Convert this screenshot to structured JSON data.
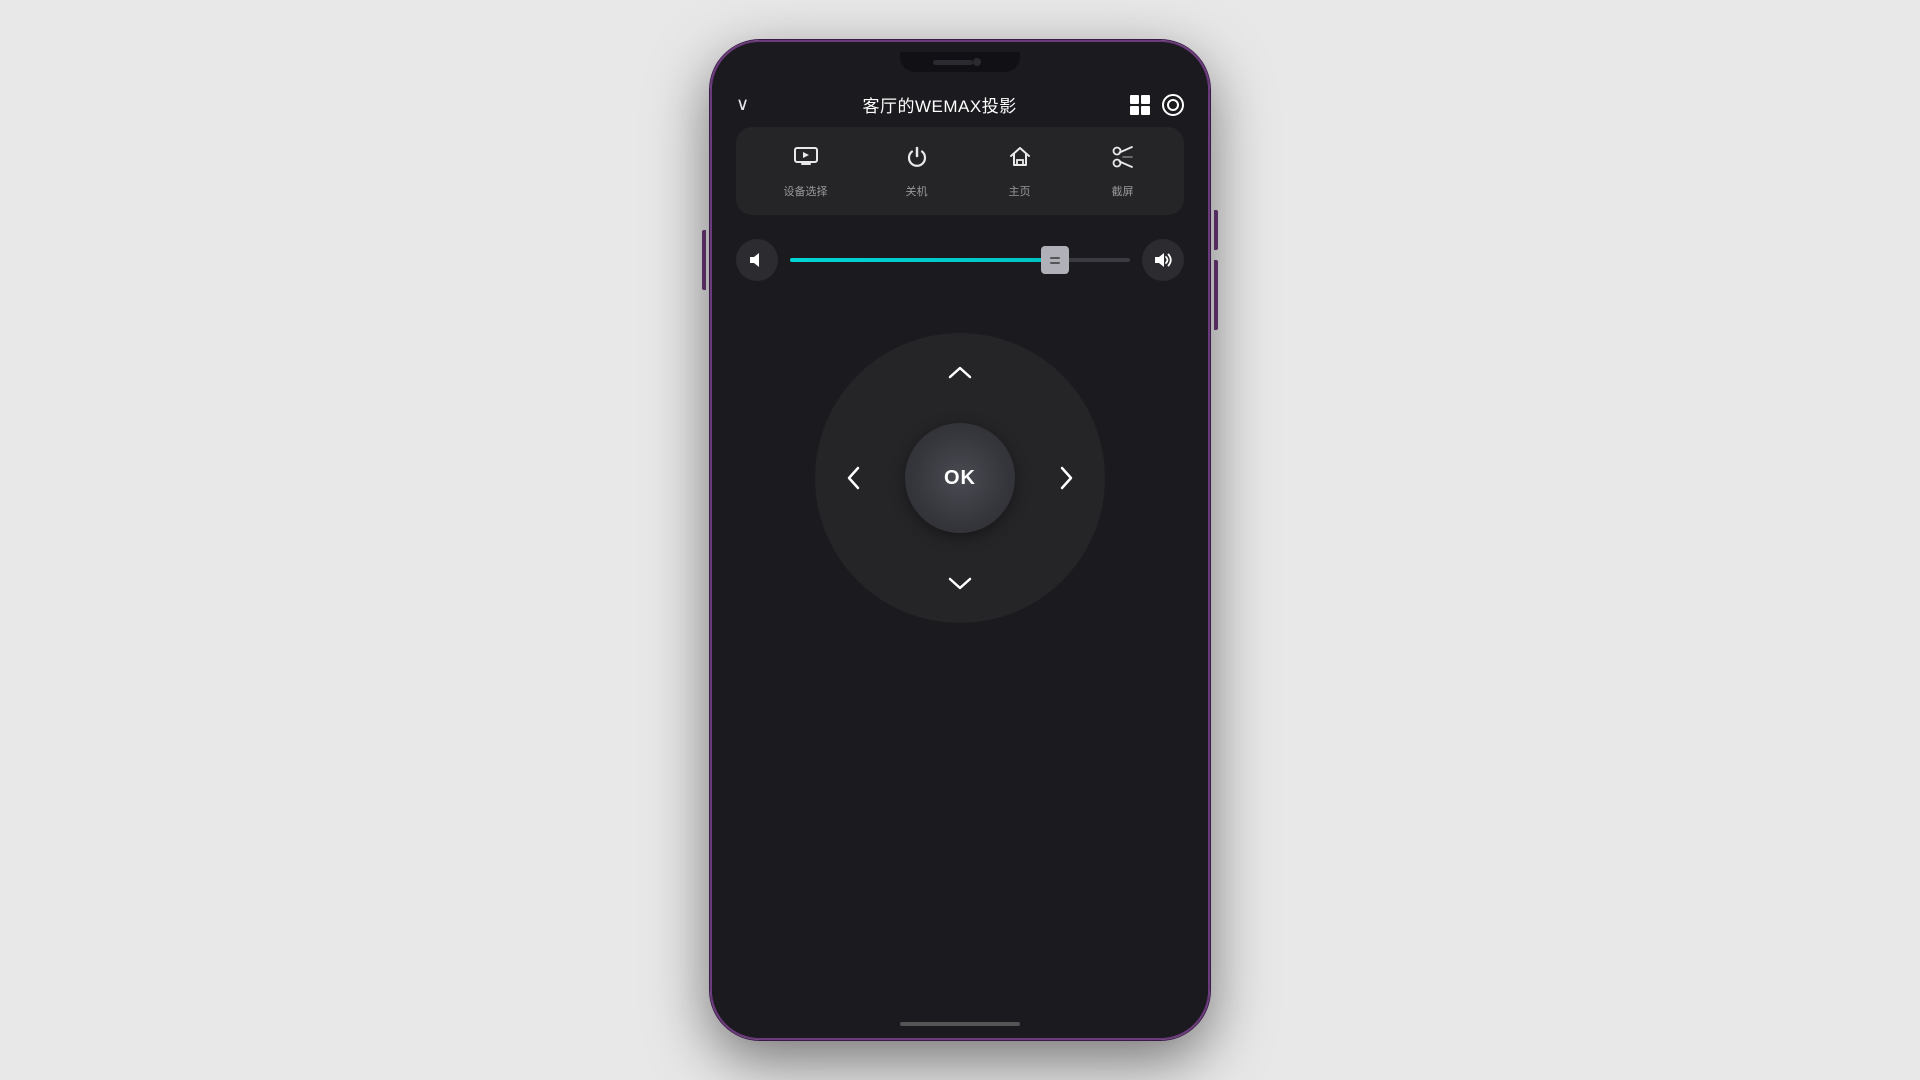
{
  "header": {
    "title": "客厅的WEMAX投影",
    "chevron_down": "∨",
    "grid_icon_label": "layout-icon",
    "target_icon_label": "target-icon"
  },
  "quick_actions": [
    {
      "id": "device-select",
      "label": "设备选择",
      "icon": "tv"
    },
    {
      "id": "power-off",
      "label": "关机",
      "icon": "power"
    },
    {
      "id": "home",
      "label": "主页",
      "icon": "home"
    },
    {
      "id": "screenshot",
      "label": "截屏",
      "icon": "scissors"
    }
  ],
  "volume": {
    "decrease_label": "vol-down",
    "increase_label": "vol-up",
    "slider_percent": 78
  },
  "dpad": {
    "up_label": "∧",
    "down_label": "∨",
    "left_label": "<",
    "right_label": ">",
    "center_label": "OK"
  },
  "colors": {
    "accent": "#00c4c4",
    "background": "#1a1a1f",
    "card_bg": "#252528",
    "phone_border": "#6a3a7a",
    "text_primary": "#ffffff",
    "text_secondary": "#999999"
  }
}
